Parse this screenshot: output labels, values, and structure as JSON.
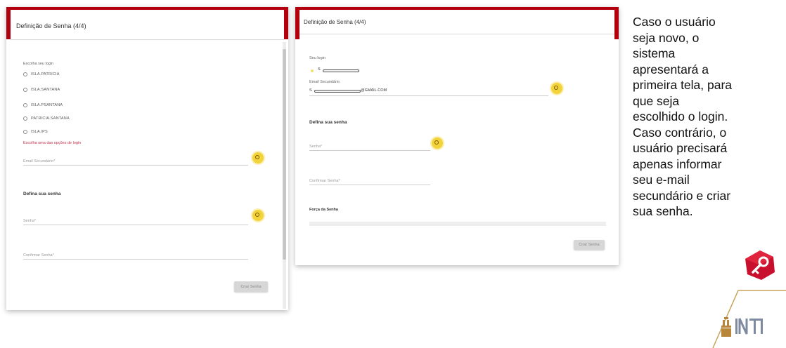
{
  "panel_left": {
    "title": "Definição de Senha (4/4)",
    "choose_login_label": "Escolha seu login",
    "login_options": [
      {
        "label": "ISLA.PATRICIA"
      },
      {
        "label": "ISLA.SANTANA"
      },
      {
        "label": "ISLA.PSANTANA"
      },
      {
        "label": "PATRICIA.SANTANA"
      },
      {
        "label": "ISLA.IPS"
      }
    ],
    "error_message": "Escolha uma das opções de login",
    "secondary_email_placeholder": "Email Secundário*",
    "define_password_title": "Defina sua senha",
    "password_placeholder": "Senha*",
    "confirm_password_placeholder": "Confirmar Senha*",
    "submit_label": "Criar Senha"
  },
  "panel_right": {
    "title": "Definição de Senha (4/4)",
    "your_login_label": "Seu login",
    "login_value_prefix": "S",
    "secondary_email_label": "Email Secundário",
    "secondary_email_value_prefix": "S",
    "secondary_email_value_suffix": "@GMAIL.COM",
    "define_password_title": "Defina sua senha",
    "password_placeholder": "Senha*",
    "confirm_password_placeholder": "Confirmar Senha*",
    "strength_label": "Força da Senha",
    "submit_label": "Criar Senha"
  },
  "explanation": {
    "lines": [
      "Caso o usuário",
      "seja novo, o",
      "sistema",
      "apresentará a",
      "primeira tela, para",
      "que seja",
      "escolhido o login.",
      "Caso contrário, o",
      "usuário precisará",
      "apenas informar",
      "seu e-mail",
      "secundário e criar",
      "sua senha."
    ]
  },
  "icons": {
    "help": "help-icon",
    "key": "key-icon",
    "logo": "institution-logo"
  },
  "colors": {
    "accent_red": "#b3000f",
    "help_yellow": "#f2d33a",
    "error_red": "#c0354b"
  }
}
